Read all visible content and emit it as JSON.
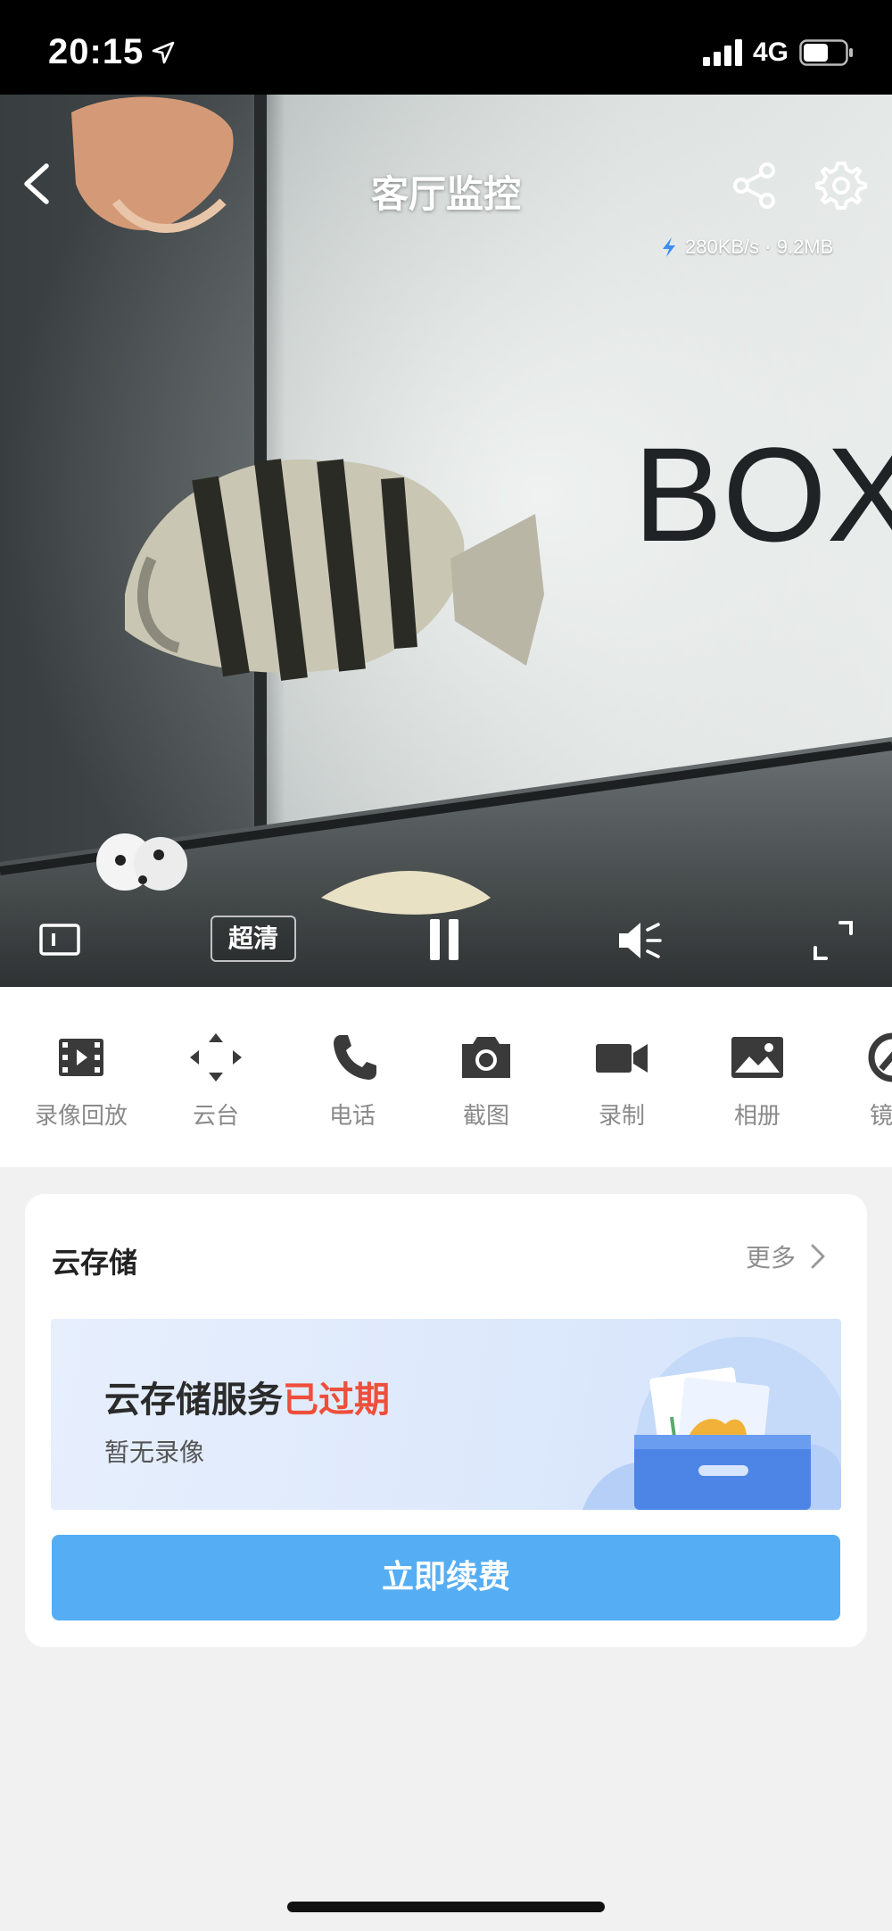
{
  "status_bar": {
    "time": "20:15",
    "network": "4G"
  },
  "video": {
    "title": "客厅监控",
    "bitrate": "280KB/s · 9.2MB",
    "scene_sign_text": "BOX",
    "quality_label": "超清"
  },
  "toolbar": {
    "items": [
      {
        "label": "录像回放",
        "icon": "film-icon"
      },
      {
        "label": "云台",
        "icon": "move-arrows-icon"
      },
      {
        "label": "电话",
        "icon": "phone-icon"
      },
      {
        "label": "截图",
        "icon": "camera-icon"
      },
      {
        "label": "录制",
        "icon": "video-camera-icon"
      },
      {
        "label": "相册",
        "icon": "image-icon"
      },
      {
        "label": "镜头",
        "icon": "lens-icon"
      }
    ]
  },
  "cloud": {
    "title": "云存储",
    "more_label": "更多",
    "banner_title": "云存储服务",
    "banner_status": "已过期",
    "banner_subtitle": "暂无录像",
    "renew_label": "立即续费"
  },
  "colors": {
    "accent": "#55aef4",
    "expired": "#ef4e3b",
    "label_gray": "#8a8a8a"
  }
}
